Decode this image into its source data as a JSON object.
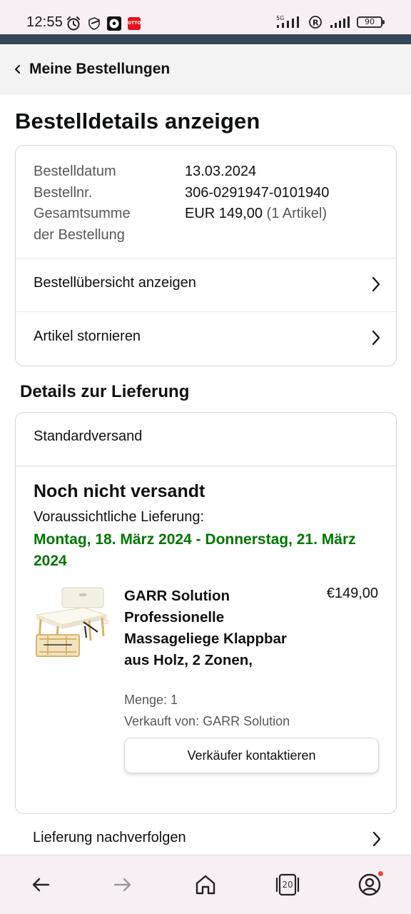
{
  "status_bar": {
    "time": "12:55",
    "network": "5G",
    "battery": "90",
    "icons_left": [
      "alarm-icon",
      "shield-icon",
      "soccer-ball-icon",
      "otto-app-icon"
    ],
    "icons_right": [
      "signal-5g-icon",
      "roaming-icon",
      "signal-icon",
      "battery-icon"
    ],
    "otto_label": "OTTO"
  },
  "header": {
    "back_label": "Meine Bestellungen"
  },
  "page_title": "Bestelldetails anzeigen",
  "order": {
    "date_label": "Bestelldatum",
    "date_value": "13.03.2024",
    "number_label": "Bestellnr.",
    "number_value": "306-0291947-0101940",
    "total_label_line1": "Gesamtsumme",
    "total_label_line2": "der Bestellung",
    "total_value": "EUR 149,00",
    "total_items": "(1 Artikel)",
    "links": [
      {
        "label": "Bestellübersicht anzeigen"
      },
      {
        "label": "Artikel stornieren"
      }
    ]
  },
  "delivery": {
    "section_title": "Details zur Lieferung",
    "method": "Standardversand",
    "status": "Noch nicht versandt",
    "expected_label": "Voraussichtliche Lieferung:",
    "expected_date": "Montag, 18. März 2024 - Donnerstag, 21. März 2024",
    "product": {
      "title": "GARR Solution Professionelle Massageliege Klappbar aus Holz, 2 Zonen,",
      "price": "€149,00",
      "quantity": "Menge: 1",
      "seller": "Verkauft von: GARR Solution",
      "contact_button": "Verkäufer kontaktieren"
    },
    "track_label": "Lieferung nachverfolgen"
  },
  "bottom_nav": {
    "tab_count": "20",
    "items": [
      "back-arrow-icon",
      "forward-arrow-icon",
      "home-icon",
      "tabs-icon",
      "account-icon"
    ]
  },
  "colors": {
    "accent_green": "#007600",
    "top_band": "#37475a",
    "text": "#0f1111",
    "muted": "#565959"
  }
}
